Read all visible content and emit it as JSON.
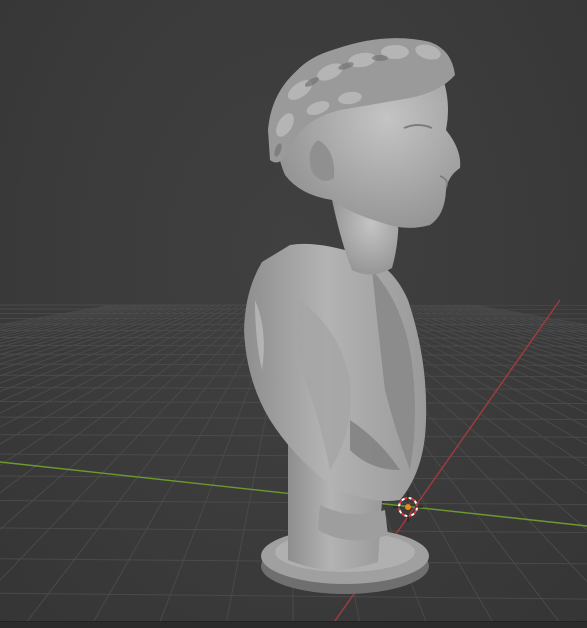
{
  "viewport": {
    "background": "#3d3d3d",
    "grid_color": "#4a4a4a",
    "x_axis_color": "#a33a3e",
    "y_axis_color": "#6c9a2e",
    "origin_marker_color": "#e88a1a",
    "object": {
      "type": "mesh",
      "subject": "laureate-bust",
      "shading": "solid",
      "base_color": "#a9a9a9"
    }
  }
}
